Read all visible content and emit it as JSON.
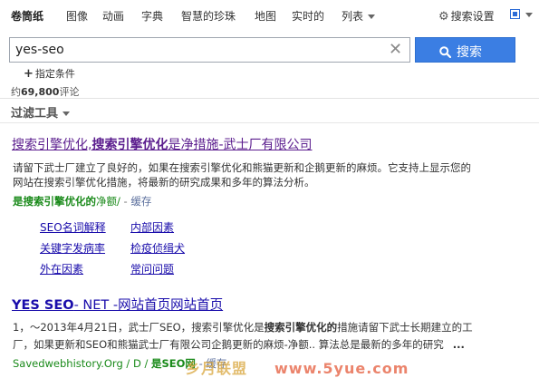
{
  "nav": {
    "items": [
      "卷筒纸",
      "图像",
      "动画",
      "字典",
      "智慧的珍珠",
      "地图",
      "实时的",
      "列表"
    ],
    "settings_label": "搜索设置"
  },
  "search": {
    "query": "yes-seo",
    "button_label": "搜索"
  },
  "conditions_label": "指定条件",
  "result_count": {
    "prefix": "约",
    "number": "69,800",
    "suffix": "评论"
  },
  "filter_label": "过滤工具",
  "results": [
    {
      "title_a": "搜索引擎优化,",
      "title_b": "搜索引擎优化",
      "title_c": "是净措施-武士厂有限公司",
      "snippet_1": "请留下武士厂建立了良好的，如果在搜索引擎优化和熊猫更新和企鹅更新的麻烦。它支持上显示您的",
      "snippet_2": "网站在搜索引擎优化措施，将最新的研究成果和多年的算法分析。",
      "url_a": "是搜索引擎优化的",
      "url_b": "净额/",
      "url_sep": " - ",
      "cache": "缓存",
      "sitelinks": [
        "SEO名词解释",
        "内部因素",
        "关键字发病率",
        "检疫侦缉犬",
        "外在因素",
        "常问问题"
      ]
    },
    {
      "title_a": "YES SEO",
      "title_b": "- NET -网站首页网站首页",
      "snippet_1a": "1，〜2013年4月21日，武士厂SEO，搜索引擎优化是",
      "snippet_1b": "搜索引擎优化的",
      "snippet_1c": "措施请留下武士长期建立的工",
      "snippet_2": "厂，如果更新和SEO和熊猫武士厂有限公司企鹅更新的麻烦-净额.. 算法总是最新的多年的研究",
      "snippet_ellipsis": "...",
      "url_a": "Savedwebhistory.Org / D /",
      "url_b": "是SEO网",
      "url_c": "- 缓存"
    }
  ],
  "watermark": {
    "left": "乡月联盟",
    "right": "www.5yue.com"
  }
}
